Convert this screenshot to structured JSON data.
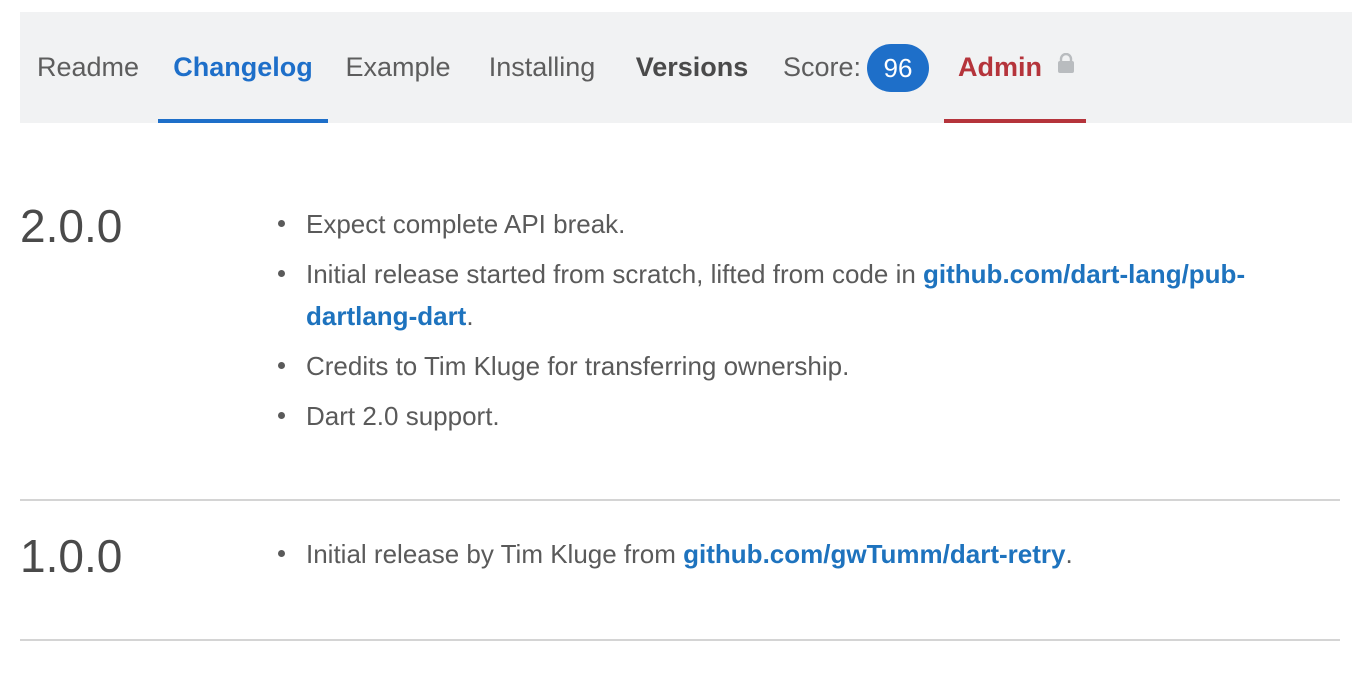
{
  "tabs": {
    "readme": "Readme",
    "changelog": "Changelog",
    "example": "Example",
    "installing": "Installing",
    "versions": "Versions",
    "score_label": "Score:",
    "score_value": "96",
    "admin": "Admin"
  },
  "colors": {
    "active_tab": "#1e6fc9",
    "admin_tab": "#b5343b",
    "link": "#1e73be",
    "tab_bar_bg": "#f1f2f3"
  },
  "icons": {
    "admin_lock": "lock-icon"
  },
  "releases": [
    {
      "version": "2.0.0",
      "notes": [
        {
          "text": "Expect complete API break."
        },
        {
          "text": "Initial release started from scratch, lifted from code in ",
          "link": "github.com/dart-lang/pub-dartlang-dart",
          "after": "."
        },
        {
          "text": "Credits to Tim Kluge for transferring ownership."
        },
        {
          "text": "Dart 2.0 support."
        }
      ]
    },
    {
      "version": "1.0.0",
      "notes": [
        {
          "text": "Initial release by Tim Kluge from ",
          "link": "github.com/gwTumm/dart-retry",
          "after": "."
        }
      ]
    }
  ]
}
